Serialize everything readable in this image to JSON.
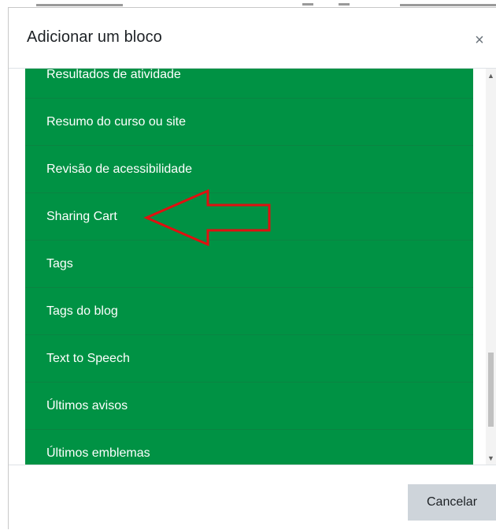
{
  "dialog": {
    "title": "Adicionar um bloco",
    "close_label": "×",
    "cancel_label": "Cancelar"
  },
  "blocks": [
    "Resultados de atividade",
    "Resumo do curso ou site",
    "Revisão de acessibilidade",
    "Sharing Cart",
    "Tags",
    "Tags do blog",
    "Text to Speech",
    "Últimos avisos",
    "Últimos emblemas"
  ],
  "colors": {
    "list_background": "#009244",
    "annotation_arrow": "#e01010"
  },
  "annotation": {
    "type": "red-arrow",
    "points_to": "Sharing Cart"
  }
}
